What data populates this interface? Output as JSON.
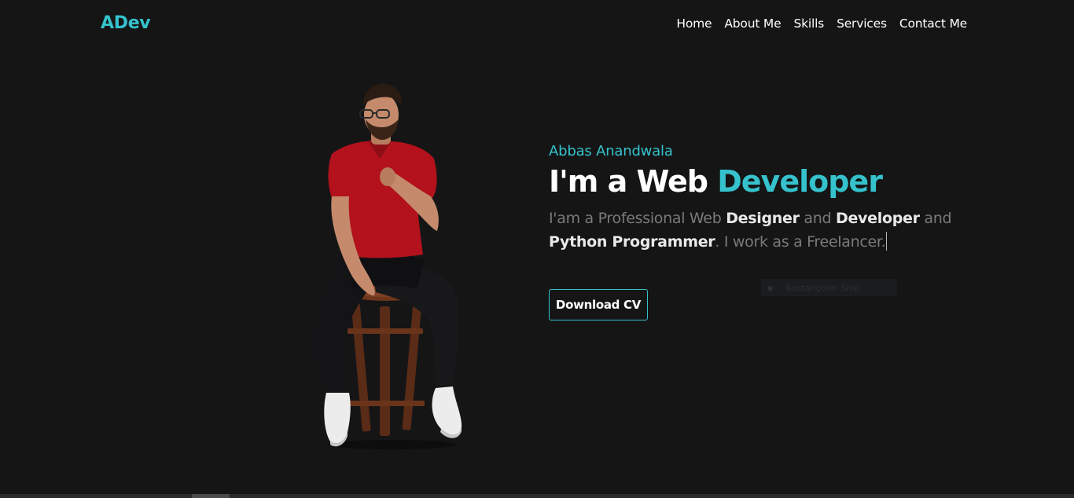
{
  "nav": {
    "logo": "ADev",
    "links": [
      "Home",
      "About Me",
      "Skills",
      "Services",
      "Contact Me"
    ]
  },
  "hero": {
    "name": "Abbas Anandwala",
    "headline_prefix": "I'm a Web ",
    "headline_accent": "Developer",
    "intro": {
      "part1": "I'am a Professional Web ",
      "bold1": "Designer",
      "part2": " and ",
      "bold2": "Developer",
      "part3": " and ",
      "bold3": "Python Programmer",
      "part4": ". I work as a Freelancer."
    },
    "cv_button": "Download CV"
  },
  "overlay": {
    "tooltip_text": "Rectangular Snip"
  },
  "colors": {
    "accent": "#35c2cc",
    "background": "#151516",
    "shirt": "#b3121c"
  },
  "icons": {
    "tooltip": "snip-icon"
  }
}
